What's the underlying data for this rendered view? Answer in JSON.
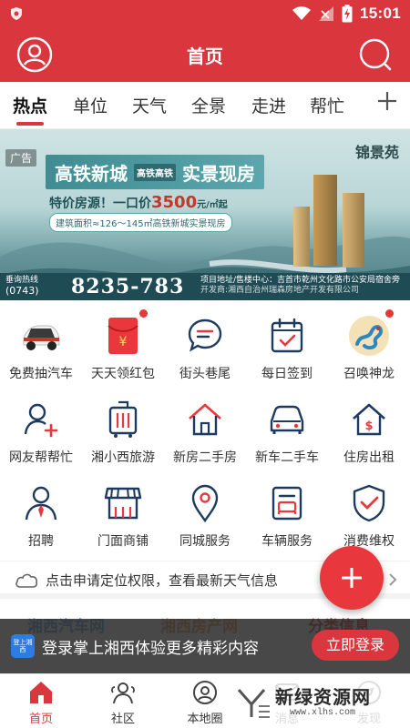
{
  "status_bar": {
    "time": "15:01"
  },
  "header": {
    "title": "首页"
  },
  "tabs": [
    {
      "label": "热点",
      "active": true
    },
    {
      "label": "单位"
    },
    {
      "label": "天气"
    },
    {
      "label": "全景"
    },
    {
      "label": "走进"
    },
    {
      "label": "帮忙"
    }
  ],
  "banner": {
    "ad_tag": "广告",
    "headline_left": "高铁新城",
    "headline_mid": "高铁高铁",
    "headline_right": "实景现房",
    "logo": "锦景苑",
    "price_prefix": "特价房源！一口价",
    "price_value": "3500",
    "price_unit": "元/㎡起",
    "area_text": "建筑面积≈126～145㎡高铁新城实景现房",
    "hotline_label": "垂询热线",
    "area_code": "(0743)",
    "phone": "8235-783",
    "address": "项目地址/售楼中心：吉首市乾州文化路市公安局宿舍旁",
    "developer": "开发商:湘西自治州瑞森房地产开发有限公司"
  },
  "grid": [
    {
      "label": "免费抽汽车",
      "icon": "car-icon",
      "dot": false
    },
    {
      "label": "天天领红包",
      "icon": "red-envelope-icon",
      "dot": true
    },
    {
      "label": "街头巷尾",
      "icon": "chat-bubble-icon",
      "dot": false
    },
    {
      "label": "每日签到",
      "icon": "calendar-check-icon",
      "dot": false
    },
    {
      "label": "召唤神龙",
      "icon": "dragon-icon",
      "dot": true
    },
    {
      "label": "网友帮帮忙",
      "icon": "user-add-icon",
      "dot": false
    },
    {
      "label": "湘小西旅游",
      "icon": "suitcase-icon",
      "dot": false
    },
    {
      "label": "新房二手房",
      "icon": "house-icon",
      "dot": false
    },
    {
      "label": "新车二手车",
      "icon": "car-outline-icon",
      "dot": false
    },
    {
      "label": "住房出租",
      "icon": "house-rent-icon",
      "dot": false
    },
    {
      "label": "招聘",
      "icon": "recruit-icon",
      "dot": false
    },
    {
      "label": "门面商铺",
      "icon": "shop-icon",
      "dot": false
    },
    {
      "label": "同城服务",
      "icon": "location-icon",
      "dot": false
    },
    {
      "label": "车辆服务",
      "icon": "vehicle-service-icon",
      "dot": false
    },
    {
      "label": "消费维权",
      "icon": "shield-check-icon",
      "dot": false
    }
  ],
  "weather": {
    "text": "点击申请定位权限，查看最新天气信息"
  },
  "categories": [
    "湘西汽车网",
    "湘西房产网",
    "分类信息"
  ],
  "login_bar": {
    "app_icon_text": "登上湘西",
    "message": "登录掌上湘西体验更多精彩内容",
    "button": "立即登录"
  },
  "bottom_nav": [
    {
      "label": "首页",
      "active": true
    },
    {
      "label": "社区"
    },
    {
      "label": "本地圈"
    },
    {
      "label": "消息"
    },
    {
      "label": "发现"
    }
  ],
  "watermark": {
    "main": "新绿资源网",
    "sub": "www.xlhs.com"
  },
  "colors": {
    "brand_red": "#d9363e",
    "icon_navy": "#1f3a5f"
  }
}
